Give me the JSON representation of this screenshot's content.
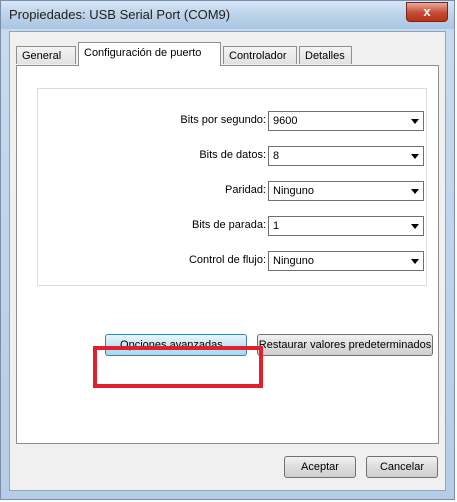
{
  "window": {
    "title": "Propiedades: USB Serial Port (COM9)",
    "close_symbol": "x"
  },
  "tabs": [
    {
      "label": "General",
      "active": false
    },
    {
      "label": "Configuración de puerto",
      "active": true
    },
    {
      "label": "Controlador",
      "active": false
    },
    {
      "label": "Detalles",
      "active": false
    }
  ],
  "settings": {
    "bits_per_second": {
      "label": "Bits por segundo:",
      "value": "9600"
    },
    "data_bits": {
      "label": "Bits de datos:",
      "value": "8"
    },
    "parity": {
      "label": "Paridad:",
      "value": "Ninguno"
    },
    "stop_bits": {
      "label": "Bits de parada:",
      "value": "1"
    },
    "flow_control": {
      "label": "Control de flujo:",
      "value": "Ninguno"
    }
  },
  "buttons": {
    "advanced": "Opciones avanzadas...",
    "restore_defaults": "Restaurar valores predeterminados",
    "accept": "Aceptar",
    "cancel": "Cancelar"
  },
  "colors": {
    "highlight": "#e0202a",
    "close_button": "#c74a33"
  }
}
